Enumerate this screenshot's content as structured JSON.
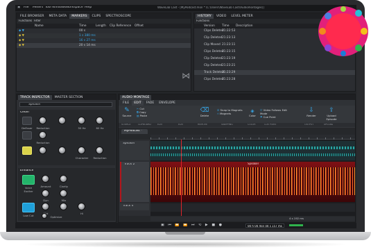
{
  "app": {
    "window_title": "WaveLab Cast - [MyPodcast.mon * (C:\\Users\\WaveLab Cast\\Audiomontages)]",
    "menu": [
      "File",
      "Meters",
      "Tool Windows",
      "Workspace",
      "Help"
    ]
  },
  "file_browser": {
    "tabs": [
      "FILE BROWSER",
      "META DATA",
      "MARKERS",
      "CLIPS",
      "SPECTROSCOPE"
    ],
    "active_tab": "MARKERS",
    "toolbar": [
      "Functions",
      "Filter"
    ],
    "columns": [
      "Name",
      "Time",
      "Length",
      "Clip Reference",
      "Offset"
    ],
    "rows": [
      {
        "name": "",
        "time": "00 s"
      },
      {
        "name": "",
        "time": "1 s 380 ms"
      },
      {
        "name": "",
        "time": "16 s 27 ms"
      },
      {
        "name": "",
        "time": "20 s 14 ms"
      }
    ]
  },
  "history": {
    "tabs": [
      "HISTORY",
      "VIDEO",
      "LEVEL METER"
    ],
    "toolbar": [
      "Functions"
    ],
    "columns": [
      "Version",
      "Time",
      "Description"
    ],
    "rows": [
      {
        "version": "Clips Deleted",
        "time": "21:22:53"
      },
      {
        "version": "Clip Deleted",
        "time": "21:23:13"
      },
      {
        "version": "Clip Moved",
        "time": "21:23:11"
      },
      {
        "version": "Clips Deleted",
        "time": "21:23:15"
      },
      {
        "version": "Clip Deleted",
        "time": "21:23:19"
      },
      {
        "version": "Clip Deleted",
        "time": "21:23:21"
      },
      {
        "version": "Track Deleted",
        "time": "21:23:29"
      },
      {
        "version": "Clips Deleted",
        "time": "21:23:28"
      }
    ]
  },
  "inspector": {
    "tabs": [
      "TRACK INSPECTOR",
      "MASTER SECTION"
    ],
    "track": "Speaker",
    "clean": {
      "title": "Clean",
      "knobs": [
        [
          "Noise Reduction",
          "Reduction",
          "Sibilance Reduction",
          "HP (Hz)"
        ],
        [
          "Reduction",
          "Lorenz",
          "Character",
          "Reduction"
        ]
      ],
      "labels": [
        "DeEsser",
        "Reduction",
        "50 Hz",
        "60 Hz",
        "Reduction",
        "Character",
        "Reduction"
      ]
    },
    "enhance": {
      "title": "Enhance",
      "labels": [
        "Voice Exciter",
        "Amount",
        "Clarity",
        "Mix",
        "Dyn",
        "Mix",
        "Low Cut",
        "Mid",
        "Hi",
        "Optimize"
      ]
    }
  },
  "montage": {
    "tab": "AUDIO MONTAGE",
    "ribbon_tabs": [
      "FILE",
      "EDIT",
      "FADE",
      "ENVELOPE"
    ],
    "active_ribbon": "EDIT",
    "groups": [
      "Source",
      "Cut",
      "Copy",
      "Paste",
      "Delete",
      "Snap to Magnets",
      "Magnets",
      "Color",
      "Video Follows Edit Mode",
      "Cue Point",
      "Render",
      "Upload Episode"
    ],
    "group_labels": [
      "SOURCE",
      "CLIPBOARD",
      "EDIT",
      "EDIT",
      "REMOVE",
      "SNAPPING",
      "COLOR",
      "CUE POINT",
      "OUTPUT",
      "UPLOAD"
    ],
    "document": "MyPodcast *",
    "tracks": [
      {
        "name": "Speaker",
        "clip": "Speaker"
      },
      {
        "name": "Track 2",
        "clip": "Speaker"
      },
      {
        "name": "Track 4",
        "clip": ""
      }
    ],
    "status": {
      "time_display": "00 h 00 min 04 s 157 ms",
      "zoom": "4 s 192 ms"
    }
  },
  "colors": {
    "accent": "#37a7e8",
    "playhead": "#e0242b",
    "waveform": "#2aa7a5",
    "selected_clip": "#b2161c",
    "active_button": "#3db6e9"
  },
  "overlay_badge": {
    "text": "",
    "icon": "colorful-circle-logo"
  }
}
